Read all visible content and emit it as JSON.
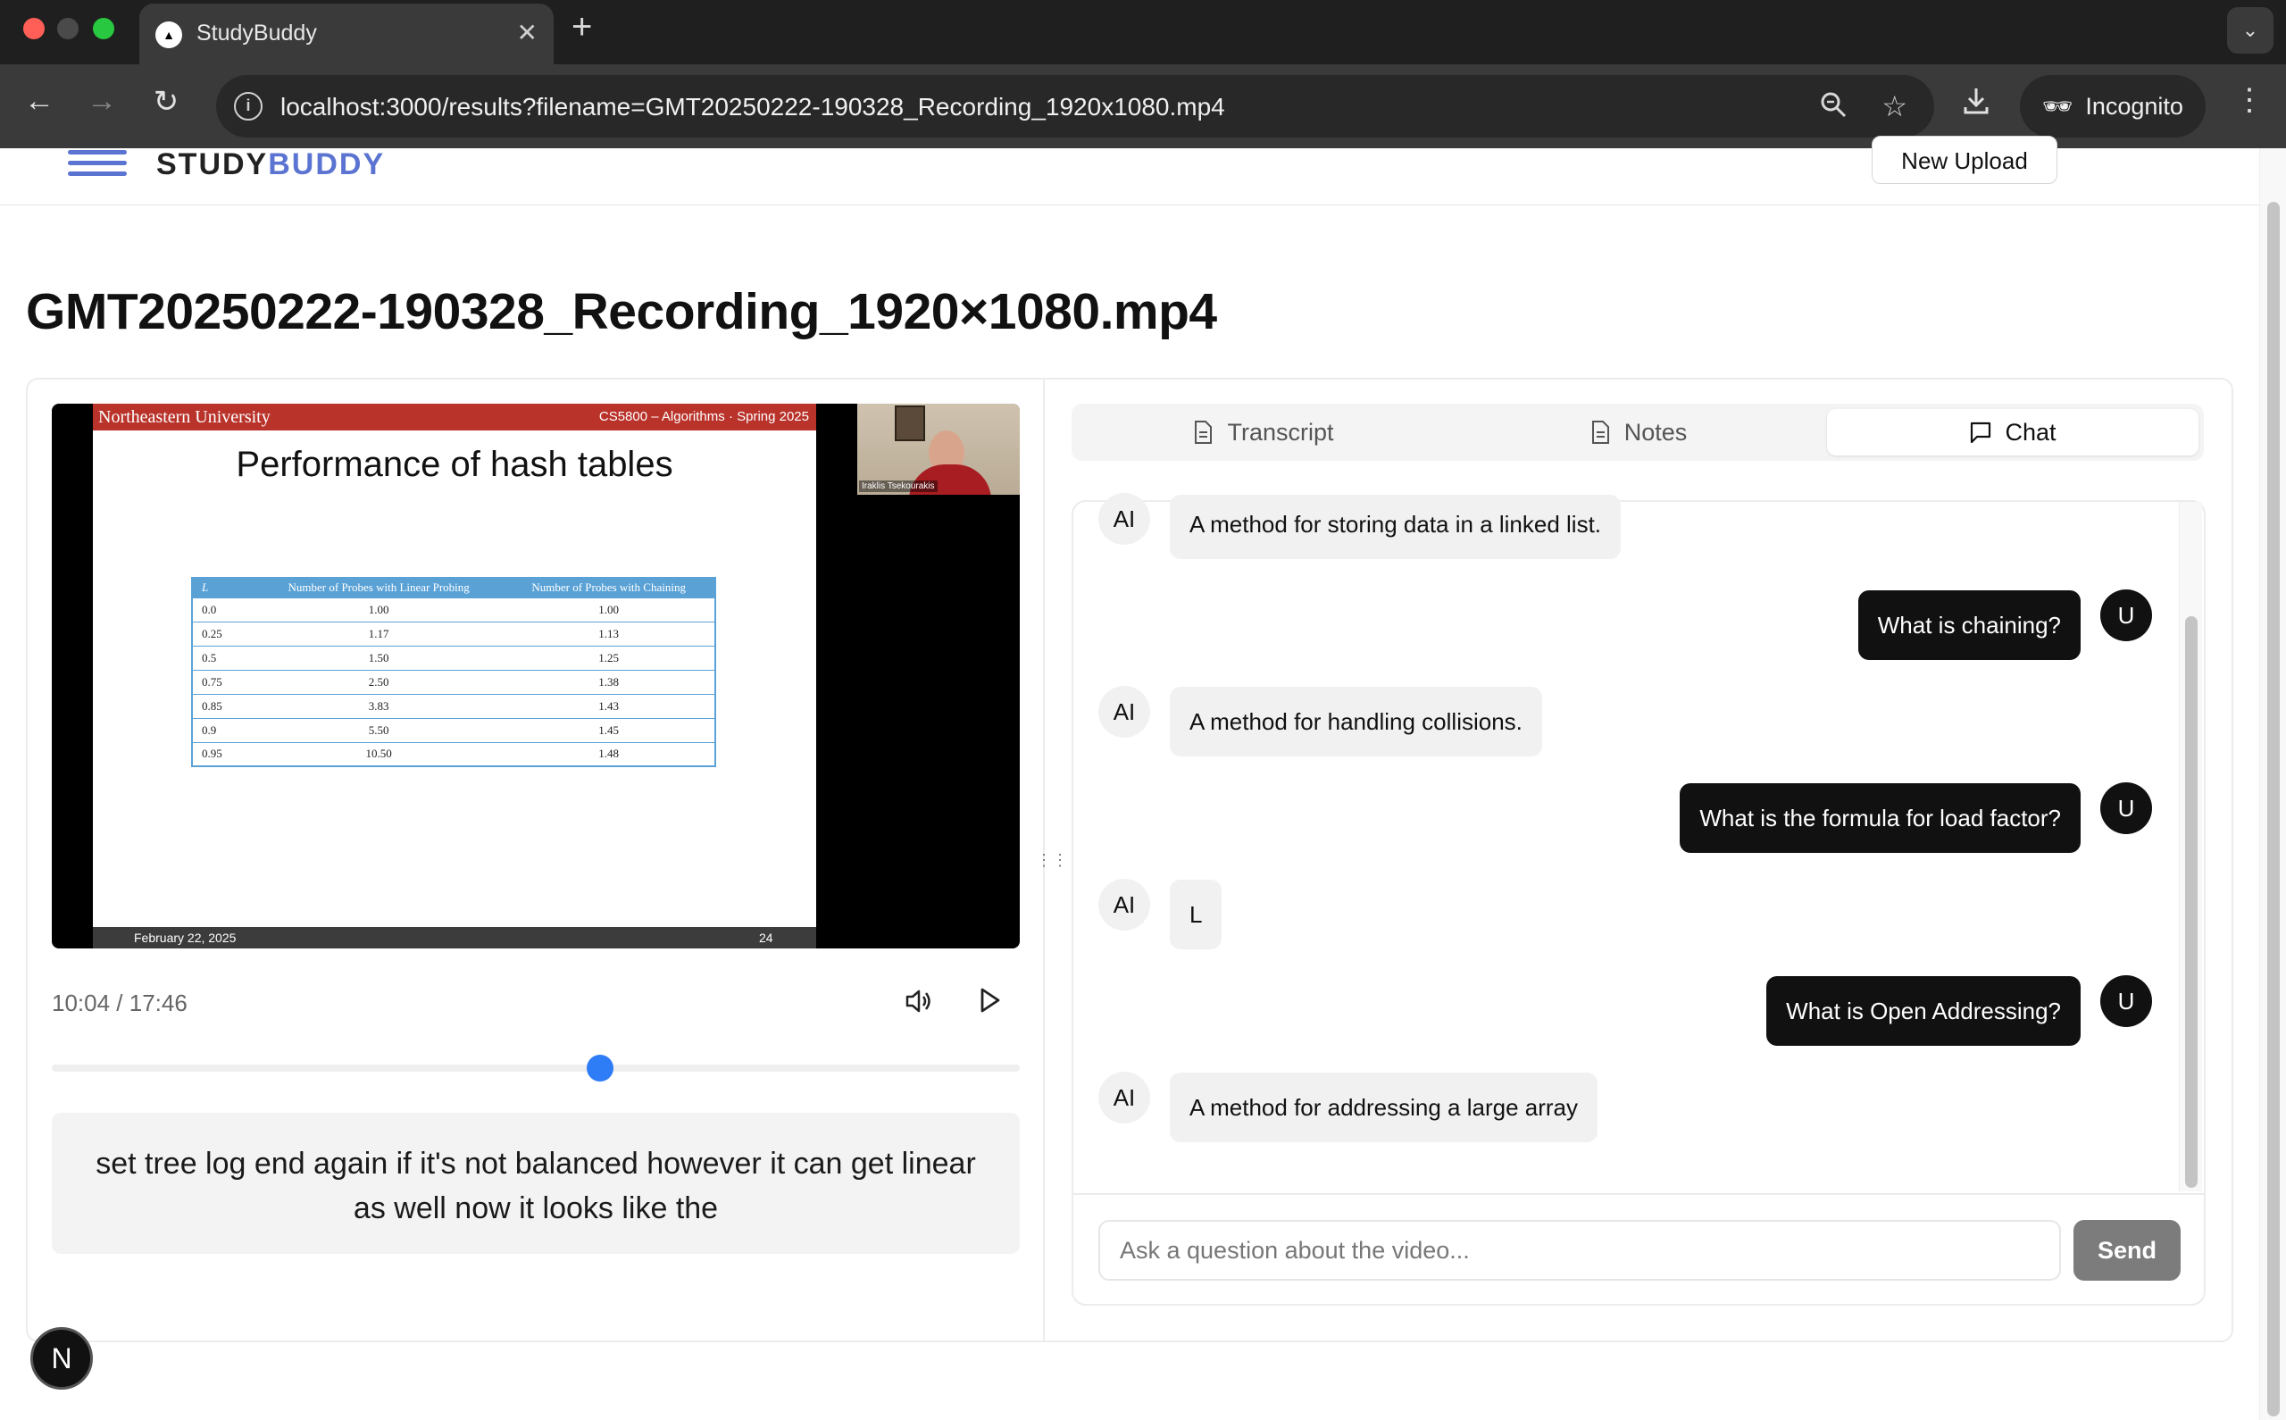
{
  "browser": {
    "tab_title": "StudyBuddy",
    "url": "localhost:3000/results?filename=GMT20250222-190328_Recording_1920x1080.mp4",
    "profile_label": "Incognito",
    "icons": [
      "back-icon",
      "forward-icon",
      "reload-icon",
      "site-info-icon",
      "zoom-icon",
      "star-icon",
      "download-icon",
      "incognito-icon",
      "menu-icon"
    ]
  },
  "header": {
    "brand_part1": "STUDY",
    "brand_part2": "BUDDY",
    "new_upload_label": "New Upload",
    "accent_color": "#5b73d1"
  },
  "page": {
    "title": "GMT20250222-190328_Recording_1920×1080.mp4"
  },
  "video": {
    "slide": {
      "institution": "Northeastern University",
      "course": "CS5800 – Algorithms  ·  Spring 2025",
      "title": "Performance of hash tables",
      "table_headers": [
        "L",
        "Number of Probes with Linear Probing",
        "Number of Probes with Chaining"
      ],
      "table_rows": [
        [
          "0.0",
          "1.00",
          "1.00"
        ],
        [
          "0.25",
          "1.17",
          "1.13"
        ],
        [
          "0.5",
          "1.50",
          "1.25"
        ],
        [
          "0.75",
          "2.50",
          "1.38"
        ],
        [
          "0.85",
          "3.83",
          "1.43"
        ],
        [
          "0.9",
          "5.50",
          "1.45"
        ],
        [
          "0.95",
          "10.50",
          "1.48"
        ]
      ],
      "footer_date": "February 22, 2025",
      "footer_page": "24"
    },
    "speaker_name": "Iraklis Tsekourakis",
    "time_display": "10:04 / 17:46",
    "progress_fraction": 0.5664,
    "caption": "set tree log end again if it's not balanced however it can get linear as well now it looks like the"
  },
  "panel": {
    "tabs": [
      {
        "label": "Transcript",
        "icon": "document-icon"
      },
      {
        "label": "Notes",
        "icon": "document-icon"
      },
      {
        "label": "Chat",
        "icon": "chat-icon",
        "active": true
      }
    ],
    "messages": [
      {
        "role": "ai",
        "badge": "AI",
        "text": "A method for storing data in a linked list."
      },
      {
        "role": "user",
        "badge": "U",
        "text": "What is chaining?"
      },
      {
        "role": "ai",
        "badge": "AI",
        "text": "A method for handling collisions."
      },
      {
        "role": "user",
        "badge": "U",
        "text": "What is the formula for load factor?"
      },
      {
        "role": "ai",
        "badge": "AI",
        "text": "L"
      },
      {
        "role": "user",
        "badge": "U",
        "text": "What is Open Addressing?"
      },
      {
        "role": "ai",
        "badge": "AI",
        "text": "A method for addressing a large array"
      }
    ],
    "input_placeholder": "Ask a question about the video...",
    "send_label": "Send"
  },
  "dev_badge": "N"
}
